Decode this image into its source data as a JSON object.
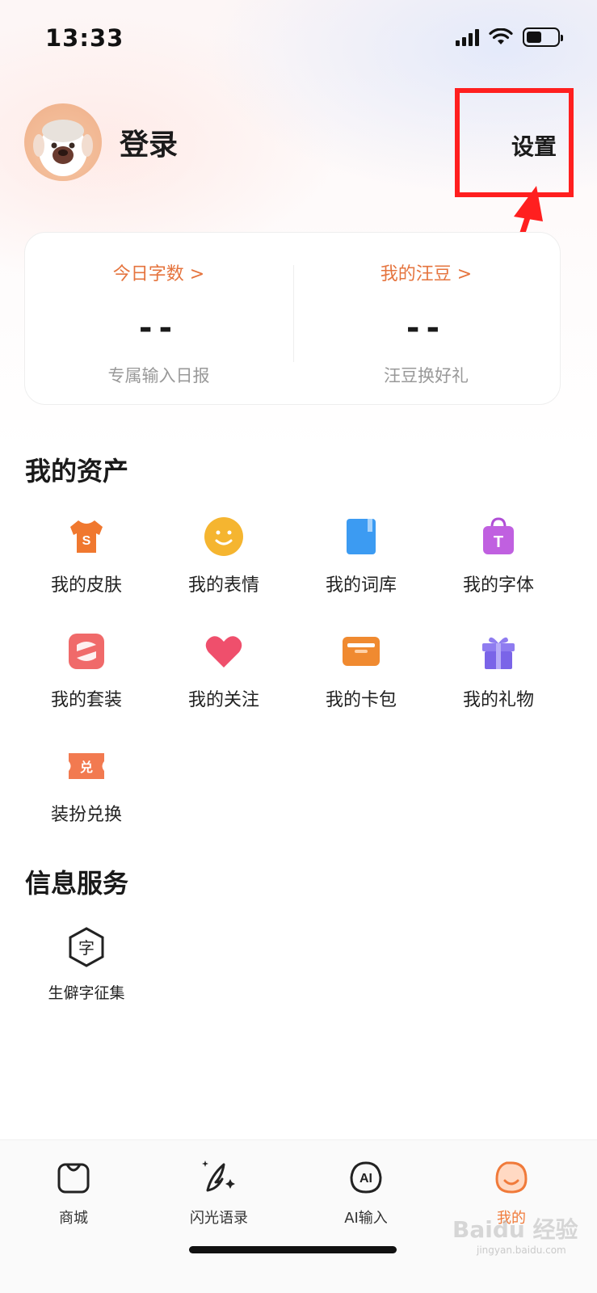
{
  "status_bar": {
    "time": "13:33",
    "icons": [
      "signal-icon",
      "wifi-icon",
      "battery-icon"
    ]
  },
  "profile": {
    "login_label": "登录",
    "settings_label": "设置"
  },
  "stats": [
    {
      "title": "今日字数 >",
      "value": "--",
      "subtitle": "专属输入日报"
    },
    {
      "title": "我的汪豆 >",
      "value": "--",
      "subtitle": "汪豆换好礼"
    }
  ],
  "assets": {
    "title": "我的资产",
    "items": [
      {
        "label": "我的皮肤",
        "icon": "shirt-icon"
      },
      {
        "label": "我的表情",
        "icon": "smiley-icon"
      },
      {
        "label": "我的词库",
        "icon": "book-icon"
      },
      {
        "label": "我的字体",
        "icon": "font-bag-icon"
      },
      {
        "label": "我的套装",
        "icon": "suit-icon"
      },
      {
        "label": "我的关注",
        "icon": "heart-icon"
      },
      {
        "label": "我的卡包",
        "icon": "card-wallet-icon"
      },
      {
        "label": "我的礼物",
        "icon": "gift-icon"
      },
      {
        "label": "装扮兑换",
        "icon": "exchange-ticket-icon"
      }
    ]
  },
  "services": {
    "title": "信息服务",
    "items": [
      {
        "label": "生僻字征集",
        "icon": "rare-char-icon"
      }
    ]
  },
  "bottom_nav": [
    {
      "label": "商城",
      "icon": "shop-bag-icon",
      "active": false
    },
    {
      "label": "闪光语录",
      "icon": "feather-sparkle-icon",
      "active": false
    },
    {
      "label": "AI输入",
      "icon": "ai-input-icon",
      "active": false
    },
    {
      "label": "我的",
      "icon": "mine-icon",
      "active": true
    }
  ],
  "colors": {
    "accent": "#e5743e",
    "active_nav": "#f07a3a",
    "highlight_annotation": "#ff1f1f"
  },
  "watermark": {
    "text": "Baidu 经验",
    "sub": "jingyan.baidu.com"
  }
}
